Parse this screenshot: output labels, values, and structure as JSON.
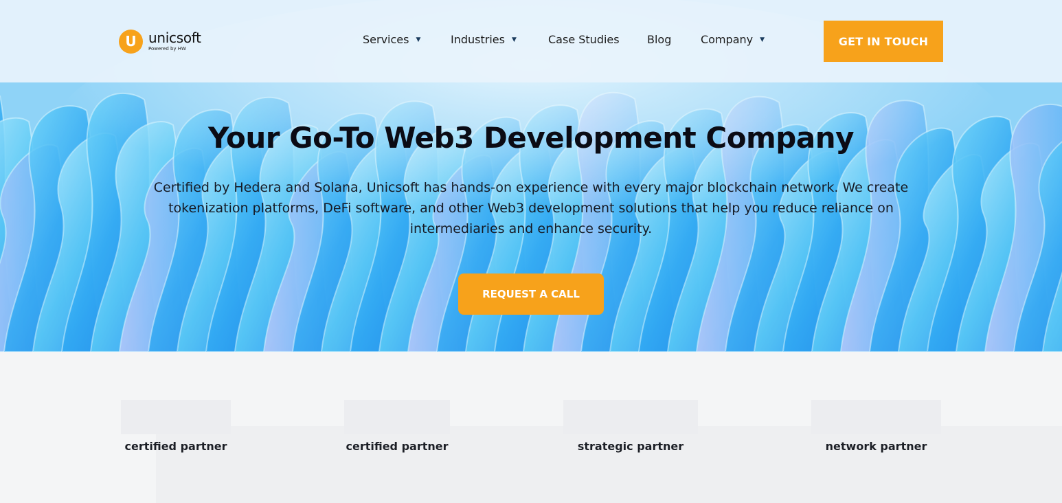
{
  "brand": {
    "logo_letter": "U",
    "name": "unicsoft",
    "tagline": "Powered by HW",
    "accent_color": "#f7a21b"
  },
  "nav": {
    "items": [
      {
        "label": "Services",
        "has_dropdown": true
      },
      {
        "label": "Industries",
        "has_dropdown": true
      },
      {
        "label": "Case Studies",
        "has_dropdown": false
      },
      {
        "label": "Blog",
        "has_dropdown": false
      },
      {
        "label": "Company",
        "has_dropdown": true
      }
    ],
    "cta_label": "GET IN TOUCH",
    "caret_icon": "caret-down-icon"
  },
  "hero": {
    "title": "Your Go-To Web3 Development Company",
    "description_lines": [
      "Certified by Hedera and Solana, Unicsoft has hands-on experience with every major blockchain network. We create",
      "tokenization platforms, DeFi software, and other Web3 development solutions that help you reduce reliance on",
      "intermediaries and enhance security."
    ],
    "cta_label": "REQUEST A CALL"
  },
  "partners": [
    {
      "label": "certified partner"
    },
    {
      "label": "certified partner"
    },
    {
      "label": "strategic partner"
    },
    {
      "label": "network partner"
    }
  ]
}
